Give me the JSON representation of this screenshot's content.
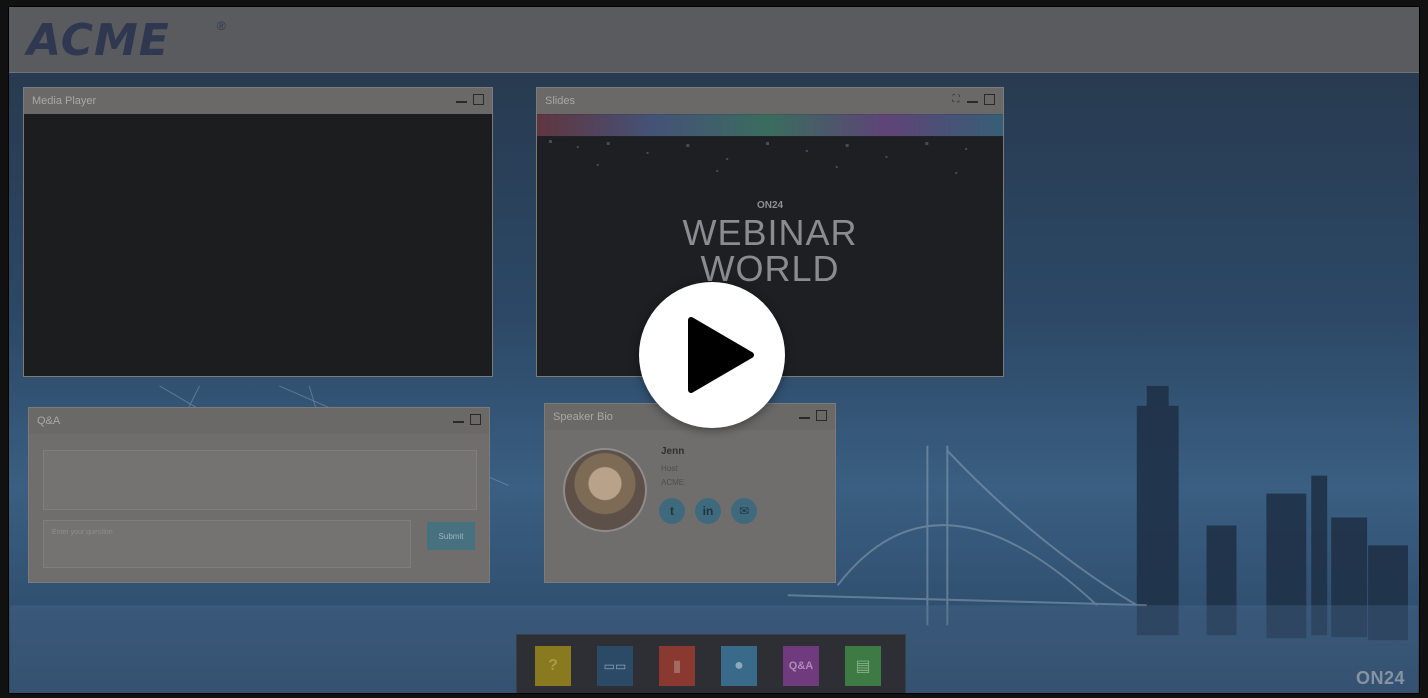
{
  "brand": {
    "logo_text": "ACME",
    "reg_mark": "®"
  },
  "panels": {
    "media_player": {
      "title": "Media Player"
    },
    "slides": {
      "title": "Slides",
      "brand": "ON24",
      "line1": "WEBINAR",
      "line2": "WORLD"
    },
    "qa": {
      "title": "Q&A",
      "input_placeholder": "Enter your question",
      "submit_label": "Submit"
    },
    "speaker_bio": {
      "title": "Speaker Bio",
      "name": "Jenn",
      "role": "Host",
      "company": "ACME",
      "social": {
        "twitter": "t",
        "linkedin": "in",
        "email": "✉"
      }
    }
  },
  "dock": {
    "help": "?",
    "slides": "▭▭",
    "media": "▮",
    "bio": "●",
    "qa": "Q&A",
    "resources": "▤"
  },
  "footer": {
    "platform_logo": "ON24"
  },
  "colors": {
    "overlay_play": "#ffffff",
    "dock_help": "#8a7a1f",
    "dock_slides": "#2b4a66",
    "dock_media": "#8a3930",
    "dock_bio": "#3a6a8a",
    "dock_qa": "#6f3a7e",
    "dock_resources": "#3e7a43"
  }
}
